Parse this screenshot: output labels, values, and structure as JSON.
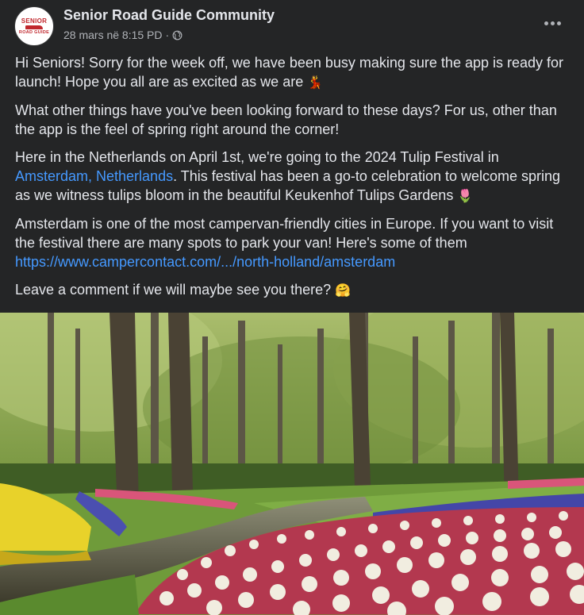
{
  "post": {
    "author": "Senior Road Guide Community",
    "logo_top": "SENIOR",
    "logo_bottom": "ROAD GUIDE",
    "timestamp": "28 mars në 8:15 PD",
    "separator": "·",
    "privacy_icon": "globe-icon",
    "more_icon": "more-options-icon",
    "paragraphs": {
      "p1_text": "Hi Seniors! Sorry for the week off, we have been busy making sure the app is ready for launch! Hope you all are as excited as we are ",
      "p1_emoji": "💃",
      "p2_text": "What other things have you've been looking forward to these days? For us, other than the app is the feel of spring right around the corner!",
      "p3_before": "Here in the Netherlands on April 1st, we're going to the 2024 Tulip Festival in ",
      "p3_link": "Amsterdam, Netherlands",
      "p3_after": ". This festival has been a go-to celebration to welcome spring as we witness tulips bloom in the beautiful Keukenhof Tulips Gardens ",
      "p3_emoji": "🌷",
      "p4_text": "Amsterdam is one of the most campervan-friendly cities in Europe. If you want to visit the festival there are many spots to park your van! Here's some of them",
      "p4_link": "https://www.campercontact.com/.../north-holland/amsterdam",
      "p5_text": "Leave a comment if we will maybe see you there? ",
      "p5_emoji": "🤗"
    },
    "image_alt": "Keukenhof tulip garden with tall trees, a stream and tulip beds"
  },
  "colors": {
    "background": "#242526",
    "text": "#e4e6eb",
    "secondary_text": "#b0b3b8",
    "link": "#4599ff",
    "logo_red": "#c0272d"
  }
}
